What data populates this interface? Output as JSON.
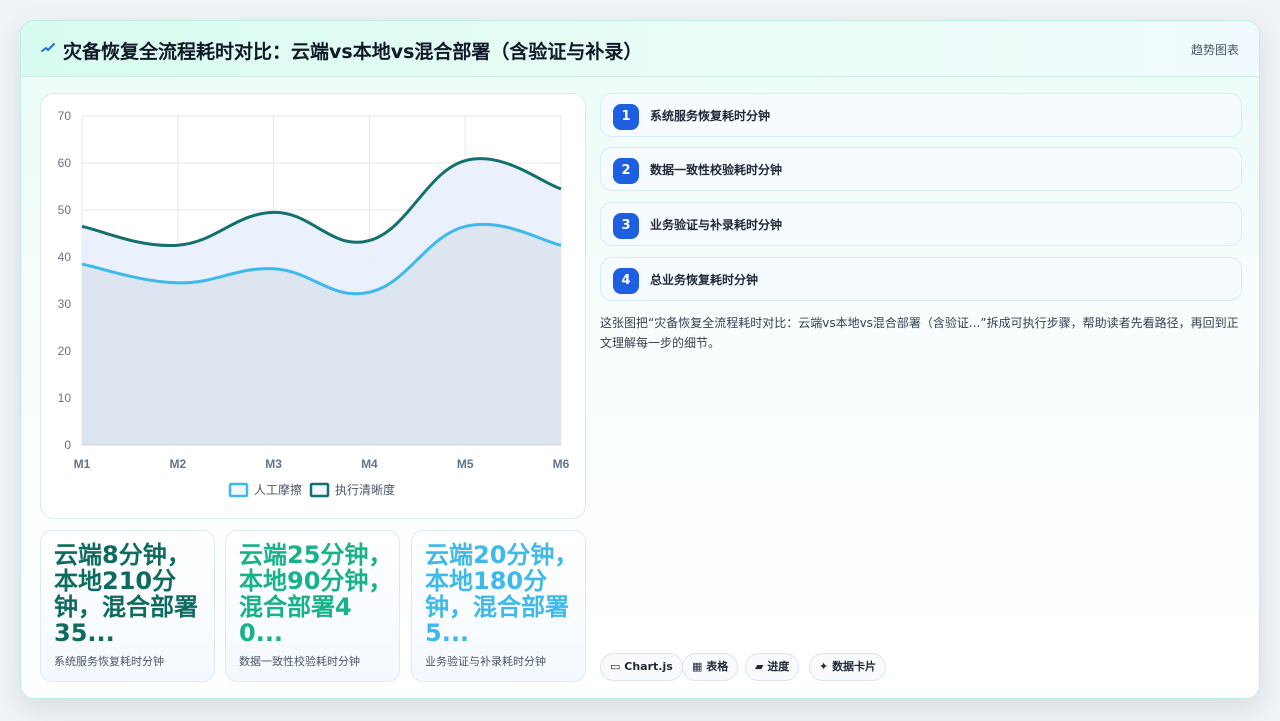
{
  "header": {
    "title": "灾备恢复全流程耗时对比：云端vs本地vs混合部署（含验证与补录）",
    "right_label": "趋势图表",
    "icon": "pulse-icon"
  },
  "chart_data": {
    "type": "line",
    "x": [
      "M1",
      "M2",
      "M3",
      "M4",
      "M5",
      "M6"
    ],
    "ylim": [
      0,
      70
    ],
    "yticks": [
      0,
      10,
      20,
      30,
      40,
      50,
      60,
      70
    ],
    "grid": true,
    "smooth": true,
    "filled": true,
    "legend_position": "bottom",
    "series": [
      {
        "name": "人工摩擦",
        "values": [
          38.5,
          34.5,
          37.5,
          32.5,
          46.5,
          42.5
        ],
        "color": "#3db9ea",
        "fill": "#dbe3ee"
      },
      {
        "name": "执行清晰度",
        "values": [
          46.5,
          42.5,
          49.5,
          43.5,
          60.5,
          54.5
        ],
        "color": "#13706e",
        "fill": "#e8effc"
      }
    ]
  },
  "stats": [
    {
      "value": "云端8分钟，本地210分钟，混合部署35...",
      "label": "系统服务恢复耗时分钟",
      "color": "#0f6b5f"
    },
    {
      "value": "云端25分钟，本地90分钟，混合部署40...",
      "label": "数据一致性校验耗时分钟",
      "color": "#16b28a"
    },
    {
      "value": "云端20分钟，本地180分钟，混合部署5...",
      "label": "业务验证与补录耗时分钟",
      "color": "#3db9ea"
    }
  ],
  "steps": [
    {
      "num": "1",
      "text": "系统服务恢复耗时分钟"
    },
    {
      "num": "2",
      "text": "数据一致性校验耗时分钟"
    },
    {
      "num": "3",
      "text": "业务验证与补录耗时分钟"
    },
    {
      "num": "4",
      "text": "总业务恢复耗时分钟"
    }
  ],
  "description": "这张图把“灾备恢复全流程耗时对比：云端vs本地vs混合部署（含验证...”拆成可执行步骤，帮助读者先看路径，再回到正文理解每一步的细节。",
  "tags": [
    {
      "icon": "window-icon",
      "glyph": "▭",
      "label": "Chart.js"
    },
    {
      "icon": "table-icon",
      "glyph": "▦",
      "label": "表格"
    },
    {
      "icon": "progress-icon",
      "glyph": "▰",
      "label": "进度"
    },
    {
      "icon": "sparkle-icon",
      "glyph": "✦",
      "label": "数据卡片"
    }
  ]
}
